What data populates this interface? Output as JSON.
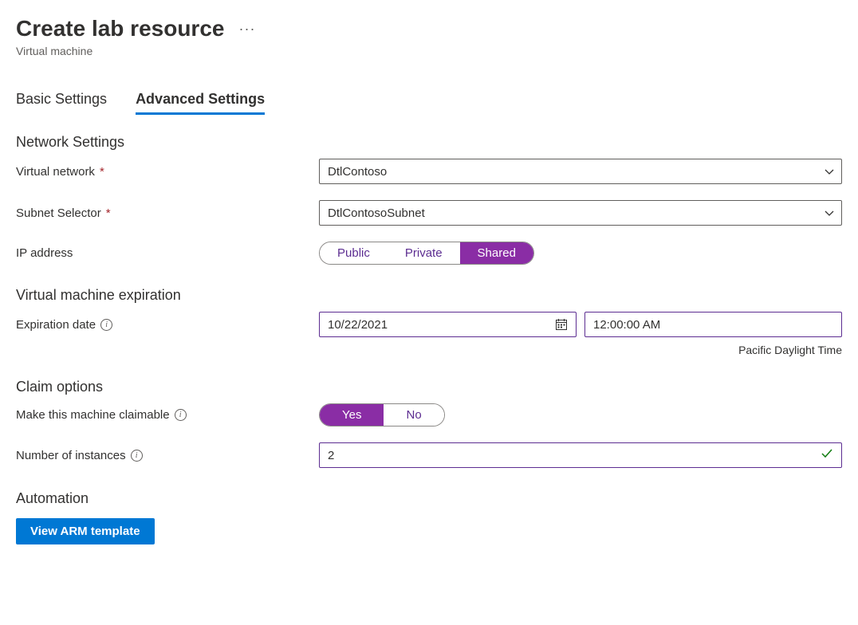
{
  "header": {
    "title": "Create lab resource",
    "subtitle": "Virtual machine"
  },
  "tabs": {
    "basic": "Basic Settings",
    "advanced": "Advanced Settings"
  },
  "sections": {
    "network": "Network Settings",
    "expiration": "Virtual machine expiration",
    "claim": "Claim options",
    "automation": "Automation"
  },
  "fields": {
    "virtual_network_label": "Virtual network",
    "virtual_network_value": "DtlContoso",
    "subnet_label": "Subnet Selector",
    "subnet_value": "DtlContosoSubnet",
    "ip_label": "IP address",
    "ip_options": {
      "public": "Public",
      "private": "Private",
      "shared": "Shared"
    },
    "expiration_date_label": "Expiration date",
    "expiration_date_value": "10/22/2021",
    "expiration_time_value": "12:00:00 AM",
    "timezone": "Pacific Daylight Time",
    "claimable_label": "Make this machine claimable",
    "claimable_options": {
      "yes": "Yes",
      "no": "No"
    },
    "instances_label": "Number of instances",
    "instances_value": "2"
  },
  "buttons": {
    "view_arm": "View ARM template"
  }
}
